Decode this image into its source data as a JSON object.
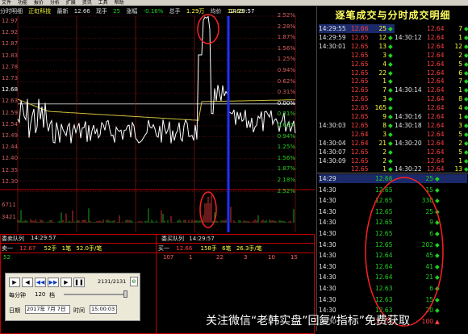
{
  "menu": [
    "文件",
    "功能",
    "报价",
    "分析",
    "扩展",
    "资讯",
    "工具",
    "帮助"
  ],
  "header": {
    "window": "分时明细",
    "stock": "正虹科技",
    "latest_label": "最新",
    "latest": "12.66",
    "now_label": "现手",
    "now": "25",
    "pct_label": "涨幅",
    "pct": "-0.16%",
    "vol_label": "总手",
    "vol": "1.29万",
    "avg_label": "均价",
    "avg": "12.69"
  },
  "price_axis": [
    "12.97",
    "12.92",
    "12.87",
    "12.83",
    "12.78",
    "12.73",
    "12.68",
    "12.63",
    "12.59",
    "12.54",
    "12.49",
    "12.44",
    "12.40",
    "12.35",
    "12.30"
  ],
  "pct_axis": [
    "2.52%",
    "2.28%",
    "1.87%",
    "1.56%",
    "1.25%",
    "0.94%",
    "0.62%",
    "0.31%",
    "0.00%",
    "0.31%",
    "0.62%",
    "0.94%",
    "1.25%",
    "1.56%",
    "1.87%",
    "2.18%",
    "2.52%"
  ],
  "vol_axis": [
    "6711",
    "3421"
  ],
  "crosshair_time": "14:29:57",
  "lower_left": {
    "title": "委卖队列",
    "time": "14:29:57",
    "sell_label": "卖一",
    "sell_price": "12.67",
    "sell_hands": "52手",
    "sell_count": "1笔",
    "sell_avg": "52.0手/笔",
    "queue": [
      "52"
    ]
  },
  "lower_right": {
    "title": "委买队列",
    "time": "14:29:57",
    "buy_label": "买一",
    "buy_price": "12.66",
    "buy_hands": "158手",
    "buy_count": "6笔",
    "buy_avg": "26.3手/笔",
    "queue": [
      "107",
      "1",
      "22",
      "3",
      "10",
      "15"
    ]
  },
  "control": {
    "counter": "2131/2131",
    "speed_label": "每分钟",
    "speed": "120",
    "speed_unit": "档",
    "date_label": "日期",
    "date": "2017年 7月 7日",
    "time_label": "时间",
    "time": "15:00:03"
  },
  "tick_title": "逐笔成交与分时成交明细",
  "ticks_left": [
    {
      "time": "14:29:55",
      "price": "12.66",
      "vol": "25"
    },
    {
      "time": "14:29:59",
      "price": "12.65",
      "vol": "12"
    },
    {
      "time": "14:30:01",
      "price": "12.65",
      "vol": "13"
    },
    {
      "time": "",
      "price": "12.65",
      "vol": "3"
    },
    {
      "time": "",
      "price": "12.65",
      "vol": "4"
    },
    {
      "time": "",
      "price": "12.65",
      "vol": "22"
    },
    {
      "time": "",
      "price": "12.65",
      "vol": "1"
    },
    {
      "time": "",
      "price": "12.65",
      "vol": "7"
    },
    {
      "time": "",
      "price": "12.65",
      "vol": "3"
    },
    {
      "time": "",
      "price": "12.65",
      "vol": "165"
    },
    {
      "time": "",
      "price": "12.65",
      "vol": "9"
    },
    {
      "time": "14:30:03",
      "price": "12.65",
      "vol": "8"
    },
    {
      "time": "",
      "price": "12.64",
      "vol": "3"
    },
    {
      "time": "14:30:04",
      "price": "12.64",
      "vol": "21"
    },
    {
      "time": "14:30:07",
      "price": "12.65",
      "vol": "2"
    },
    {
      "time": "14:30:09",
      "price": "12.65",
      "vol": "2"
    },
    {
      "time": "",
      "price": "12.65",
      "vol": "1"
    }
  ],
  "ticks_right": [
    {
      "time": "",
      "price": "12.64",
      "vol": "7"
    },
    {
      "time": "14:30:12",
      "price": "12.64",
      "vol": "1"
    },
    {
      "time": "",
      "price": "12.64",
      "vol": "12"
    },
    {
      "time": "",
      "price": "12.64",
      "vol": "2"
    },
    {
      "time": "",
      "price": "12.64",
      "vol": "5"
    },
    {
      "time": "",
      "price": "12.64",
      "vol": "6"
    },
    {
      "time": "",
      "price": "12.64",
      "vol": "7"
    },
    {
      "time": "14:30:14",
      "price": "12.64",
      "vol": "1"
    },
    {
      "time": "",
      "price": "12.64",
      "vol": "8"
    },
    {
      "time": "",
      "price": "12.64",
      "vol": "4"
    },
    {
      "time": "14:30:16",
      "price": "12.64",
      "vol": "1"
    },
    {
      "time": "14:30:18",
      "price": "12.64",
      "vol": "3"
    },
    {
      "time": "",
      "price": "12.64",
      "vol": "5"
    },
    {
      "time": "14:30:20",
      "price": "12.64",
      "vol": "2"
    },
    {
      "time": "",
      "price": "12.64",
      "vol": "5"
    },
    {
      "time": "",
      "price": "12.64",
      "vol": "1"
    },
    {
      "time": "14:30:22",
      "price": "12.64",
      "vol": "13"
    }
  ],
  "minute_rows": [
    {
      "time": "14:29",
      "price": "12.66",
      "vol": "25"
    },
    {
      "time": "14:30",
      "price": "12.65",
      "vol": "15"
    },
    {
      "time": "14:30",
      "price": "12.65",
      "vol": "330"
    },
    {
      "time": "14:30",
      "price": "12.65",
      "vol": "25"
    },
    {
      "time": "14:30",
      "price": "12.65",
      "vol": "9"
    },
    {
      "time": "14:30",
      "price": "12.65",
      "vol": "6"
    },
    {
      "time": "14:30",
      "price": "12.65",
      "vol": "202"
    },
    {
      "time": "14:30",
      "price": "12.64",
      "vol": "45"
    },
    {
      "time": "14:30",
      "price": "12.64",
      "vol": "41"
    },
    {
      "time": "14:30",
      "price": "12.64",
      "vol": "21"
    },
    {
      "time": "14:30",
      "price": "12.63",
      "vol": "6"
    },
    {
      "time": "14:30",
      "price": "12.63",
      "vol": "15"
    },
    {
      "time": "14:30",
      "price": "12.63",
      "vol": "20"
    },
    {
      "time": "14:30",
      "price": "12.65",
      "vol": "100"
    }
  ],
  "watermark": "关注微信“老韩实盘”回复“指标”免费获取",
  "colors": {
    "up": "#ff4040",
    "down": "#20d020",
    "avg_line": "#d0c040",
    "price_line": "#ffffff",
    "cursor": "#2030ff"
  }
}
